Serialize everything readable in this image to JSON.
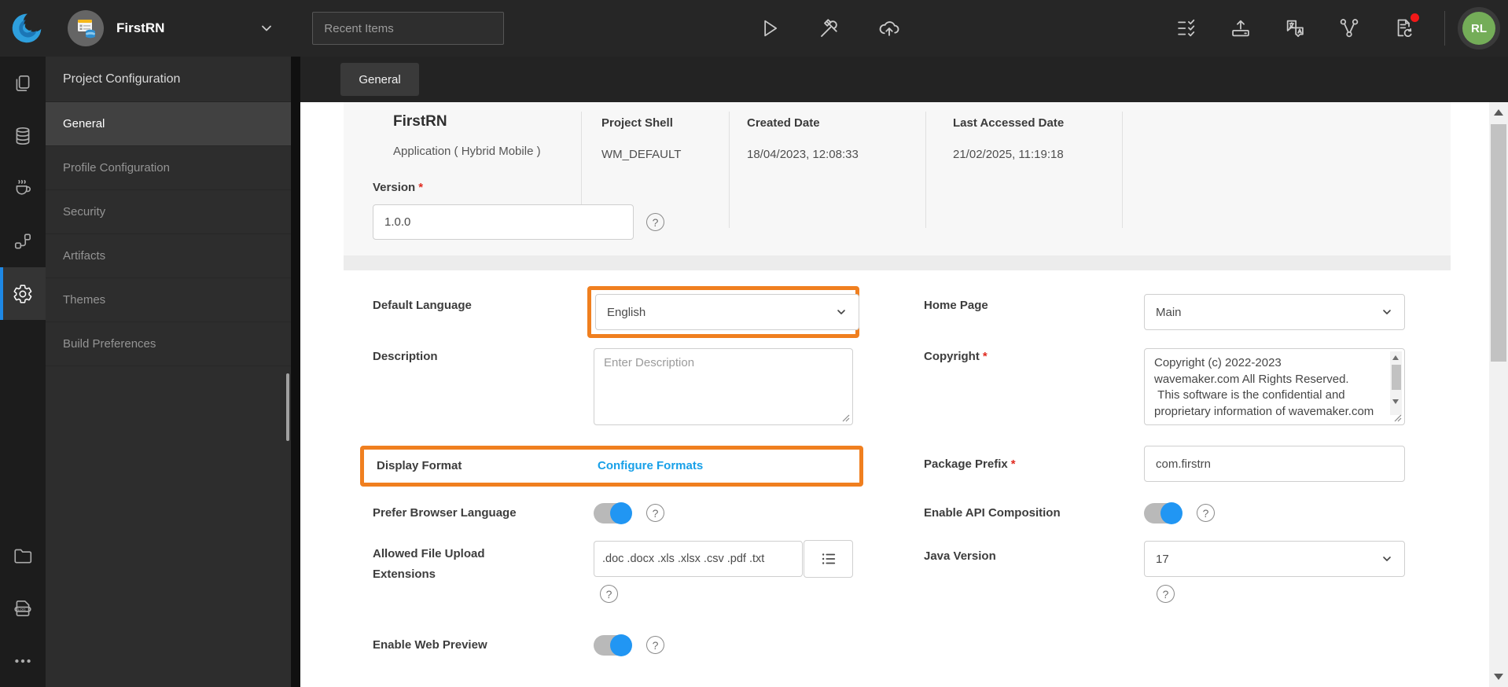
{
  "ui": {
    "help_glyph": "?",
    "required_marker": "*",
    "accent_orange": "#f07f1f",
    "link_blue": "#18a0e8",
    "toggle_blue": "#2196f3",
    "avatar_green": "#74ad58"
  },
  "topbar": {
    "project_name": "FirstRN",
    "recent_items_placeholder": "Recent Items",
    "avatar_initials": "RL"
  },
  "sidebar": {
    "header": "Project Configuration",
    "items": [
      {
        "label": "General",
        "active": true
      },
      {
        "label": "Profile Configuration",
        "active": false
      },
      {
        "label": "Security",
        "active": false
      },
      {
        "label": "Artifacts",
        "active": false
      },
      {
        "label": "Themes",
        "active": false
      },
      {
        "label": "Build Preferences",
        "active": false
      }
    ]
  },
  "tabbar": {
    "active_tab": "General"
  },
  "project_info": {
    "name": "FirstRN",
    "type": "Application ( Hybrid Mobile )",
    "columns": [
      {
        "label": "Project Shell",
        "value": "WM_DEFAULT"
      },
      {
        "label": "Created Date",
        "value": "18/04/2023, 12:08:33"
      },
      {
        "label": "Last Accessed Date",
        "value": "21/02/2025, 11:19:18"
      }
    ],
    "version": {
      "label": "Version",
      "required": true,
      "value": "1.0.0"
    }
  },
  "form": {
    "default_language": {
      "label": "Default Language",
      "value": "English",
      "highlighted": true
    },
    "home_page": {
      "label": "Home Page",
      "value": "Main"
    },
    "description": {
      "label": "Description",
      "placeholder": "Enter Description"
    },
    "copyright": {
      "label": "Copyright",
      "required": true,
      "value": "Copyright (c) 2022-2023\nwavemaker.com All Rights Reserved. \n This software is the confidential and proprietary information of wavemaker.com"
    },
    "display_format": {
      "label": "Display Format",
      "link": "Configure Formats",
      "highlighted": true
    },
    "package_prefix": {
      "label": "Package Prefix",
      "required": true,
      "value": "com.firstrn"
    },
    "prefer_browser_language": {
      "label": "Prefer Browser Language",
      "enabled": true
    },
    "enable_api_composition": {
      "label": "Enable API Composition",
      "enabled": true
    },
    "allowed_file_upload_extensions": {
      "label": "Allowed File Upload Extensions",
      "value": ".doc .docx .xls .xlsx .csv .pdf .txt"
    },
    "java_version": {
      "label": "Java Version",
      "value": "17"
    },
    "enable_web_preview": {
      "label": "Enable Web Preview",
      "enabled": true
    }
  }
}
